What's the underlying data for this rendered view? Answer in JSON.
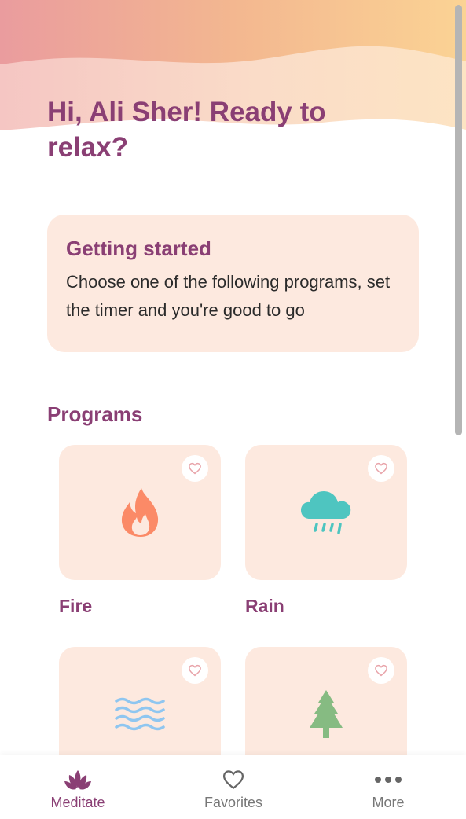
{
  "header": {
    "greeting": "Hi, Ali Sher! Ready to relax?"
  },
  "intro": {
    "title": "Getting started",
    "text": "Choose one of the following programs, set the timer and you're good to go"
  },
  "programs": {
    "heading": "Programs",
    "items": [
      {
        "label": "Fire",
        "icon": "fire-icon",
        "color": "#fb8a67"
      },
      {
        "label": "Rain",
        "icon": "rain-cloud-icon",
        "color": "#4ec5c0"
      },
      {
        "label": "",
        "icon": "water-waves-icon",
        "color": "#8fc6f0"
      },
      {
        "label": "",
        "icon": "pine-tree-icon",
        "color": "#86bb82"
      }
    ]
  },
  "nav": {
    "items": [
      {
        "label": "Meditate",
        "icon": "lotus-icon",
        "active": true
      },
      {
        "label": "Favorites",
        "icon": "heart-outline-icon",
        "active": false
      },
      {
        "label": "More",
        "icon": "more-dots-icon",
        "active": false
      }
    ]
  },
  "colors": {
    "accent": "#8a3f74",
    "card_background": "#fde9df",
    "header_gradient": [
      "#ec9a9c",
      "#f7c690",
      "#fbd9a0"
    ]
  }
}
